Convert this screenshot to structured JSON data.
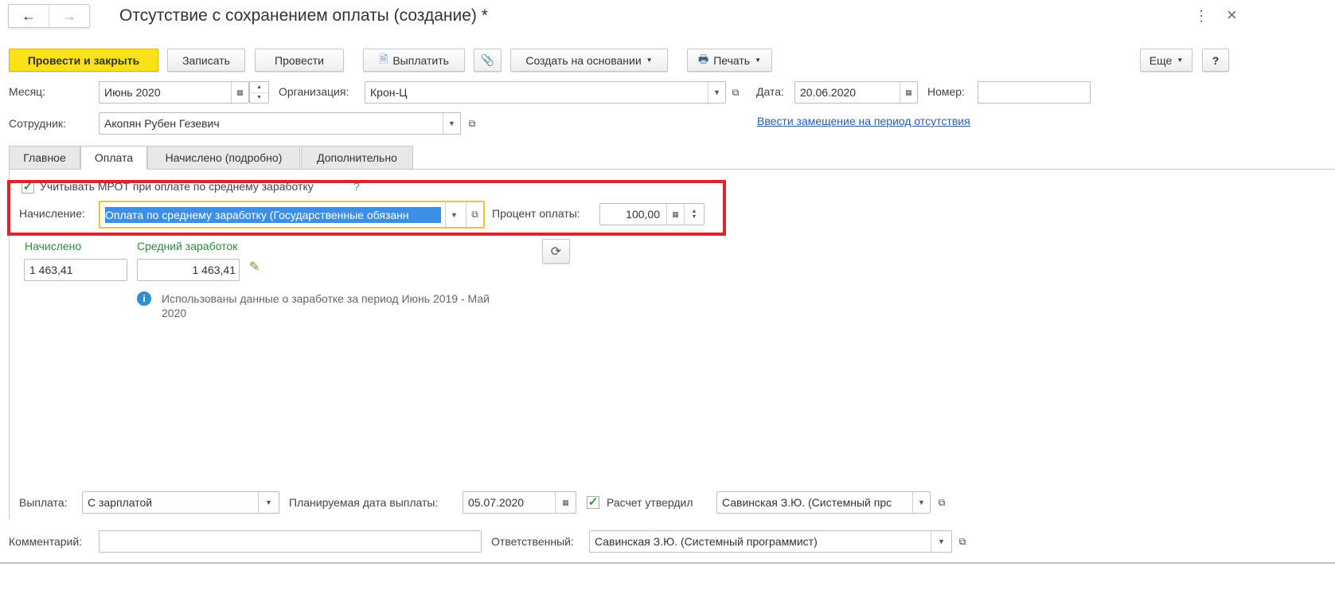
{
  "window": {
    "title": "Отсутствие с сохранением оплаты (создание) *"
  },
  "toolbar": {
    "post_close": "Провести и закрыть",
    "save": "Записать",
    "post": "Провести",
    "pay": "Выплатить",
    "create_based": "Создать на основании",
    "print": "Печать",
    "more": "Еще",
    "help": "?"
  },
  "header": {
    "month_label": "Месяц:",
    "month_value": "Июнь 2020",
    "org_label": "Организация:",
    "org_value": "Крон-Ц",
    "date_label": "Дата:",
    "date_value": "20.06.2020",
    "number_label": "Номер:",
    "number_value": "",
    "employee_label": "Сотрудник:",
    "employee_value": "Акопян Рубен Гезевич",
    "replacement_link": "Ввести замещение на период отсутствия"
  },
  "tabs": [
    {
      "label": "Главное"
    },
    {
      "label": "Оплата"
    },
    {
      "label": "Начислено (подробно)"
    },
    {
      "label": "Дополнительно"
    }
  ],
  "payment": {
    "mrot_label": "Учитывать МРОТ при оплате по среднему заработку",
    "mrot_checked": true,
    "mrot_help": "?",
    "accrual_label": "Начисление:",
    "accrual_value": "Оплата по среднему заработку (Государственные обязанн",
    "percent_label": "Процент оплаты:",
    "percent_value": "100,00",
    "accrued_label": "Начислено",
    "accrued_value": "1 463,41",
    "avg_label": "Средний заработок",
    "avg_value": "1 463,41",
    "info_text_1": "Использованы данные о заработке за период Июнь 2019 - Май",
    "info_text_2": "2020",
    "payout_label": "Выплата:",
    "payout_value": "С зарплатой",
    "planned_date_label": "Планируемая дата выплаты:",
    "planned_date_value": "05.07.2020",
    "approved_label": "Расчет утвердил",
    "approved_checked": true,
    "approved_value": "Савинская З.Ю. (Системный прс"
  },
  "footer": {
    "comment_label": "Комментарий:",
    "comment_value": "",
    "responsible_label": "Ответственный:",
    "responsible_value": "Савинская З.Ю. (Системный программист)"
  },
  "colors": {
    "accent_yellow": "#fbe117",
    "highlight": "#3b8fe6",
    "annotation_red": "#e0232b",
    "green_label": "#2e8b3a",
    "link": "#2a5db0"
  }
}
